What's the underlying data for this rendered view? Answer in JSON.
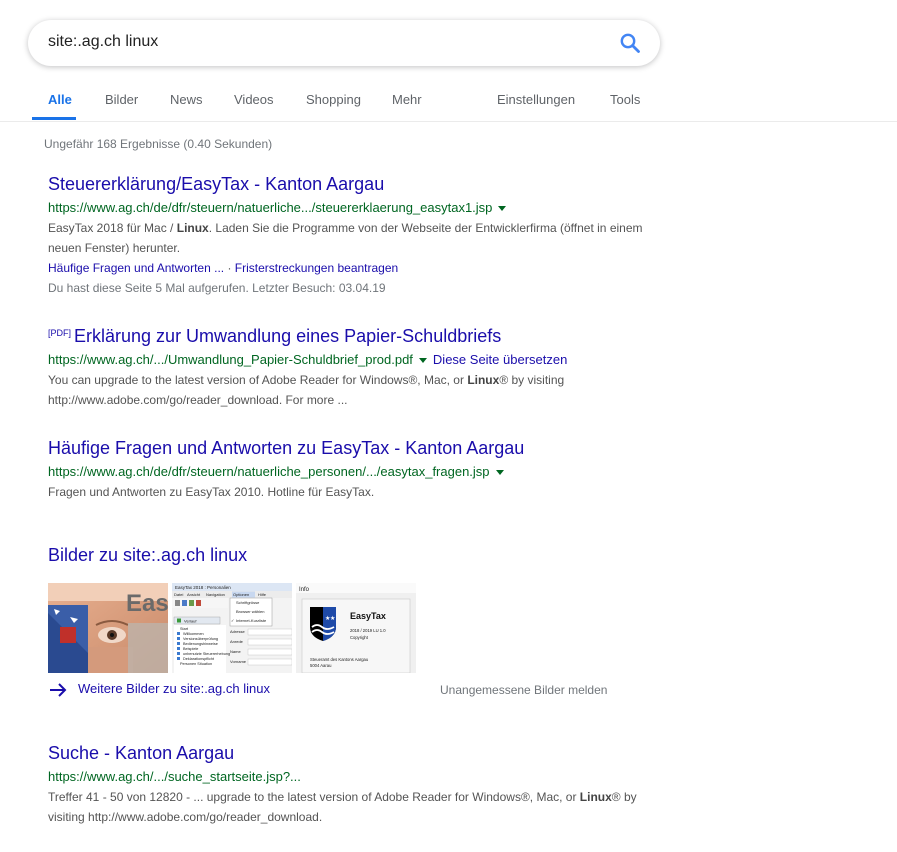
{
  "search": {
    "query": "site:.ag.ch linux"
  },
  "tabs": [
    {
      "label": "Alle",
      "active": true
    },
    {
      "label": "Bilder"
    },
    {
      "label": "News"
    },
    {
      "label": "Videos"
    },
    {
      "label": "Shopping"
    },
    {
      "label": "Mehr"
    },
    {
      "label": "Einstellungen"
    },
    {
      "label": "Tools"
    }
  ],
  "stats": "Ungefähr 168 Ergebnisse (0.40 Sekunden)",
  "results": [
    {
      "title": "Steuererklärung/EasyTax - Kanton Aargau",
      "url": "https://www.ag.ch/de/dfr/steuern/natuerliche.../steuererklaerung_easytax1.jsp",
      "snippet_a": "EasyTax 2018 für Mac / ",
      "snippet_b": "Linux",
      "snippet_c": ". Laden Sie die Programme von der Webseite der Entwicklerfirma (öffnet in einem neuen Fenster) herunter.",
      "sitelink_1": "Häufige Fragen und Antworten ...",
      "sitelink_sep": " · ",
      "sitelink_2": "Fristerstreckungen beantragen",
      "visited": "Du hast diese Seite 5 Mal aufgerufen. Letzter Besuch: 03.04.19"
    },
    {
      "tag": "[PDF]",
      "title": "Erklärung zur Umwandlung eines Papier-Schuldbriefs",
      "url": "https://www.ag.ch/.../Umwandlung_Papier-Schuldbrief_prod.pdf",
      "translate": "Diese Seite übersetzen",
      "snippet_a": "You can upgrade to the latest version of Adobe Reader for Windows®, Mac, or ",
      "snippet_b": "Linux",
      "snippet_c": "® by visiting http://www.adobe.com/go/reader_download. For more ..."
    },
    {
      "title": "Häufige Fragen und Antworten zu EasyTax - Kanton Aargau",
      "url": "https://www.ag.ch/de/dfr/steuern/natuerliche_personen/.../easytax_fragen.jsp",
      "snippet": "Fragen und Antworten zu EasyTax 2010. Hotline für EasyTax."
    },
    {
      "title": "Suche - Kanton Aargau",
      "url": "https://www.ag.ch/.../suche_startseite.jsp?...",
      "snippet_a": "Treffer 41 - 50 von 12820 - ... upgrade to the latest version of Adobe Reader for Windows®, Mac, or ",
      "snippet_b": "Linux",
      "snippet_c": "® by visiting http://www.adobe.com/go/reader_download."
    }
  ],
  "images": {
    "heading": "Bilder zu site:.ag.ch linux",
    "more": "Weitere Bilder zu site:.ag.ch linux",
    "report": "Unangemessene Bilder melden",
    "thumb1": {
      "letters": "Eas"
    },
    "thumb2": {
      "title": "EasyTax 2018 : Personalien",
      "menu": [
        "Datei",
        "Ansicht",
        "Navigation",
        "Optionen",
        "Hilfe"
      ],
      "popup": [
        "Schriftgrösse",
        "Browser wählen",
        "Internet-Kurzliste"
      ],
      "btn": "Verlauf",
      "tree": [
        "Start",
        "Willkommen",
        "Versionsüberprüfung",
        "Bedienungshinweise",
        "Beispiele",
        "unbenutzte Steuererhebung",
        "Deklarationspflicht",
        "Personen Situation"
      ],
      "fields": [
        "Adresse",
        "Anrede",
        "Name",
        "Vorname"
      ]
    },
    "thumb3": {
      "window": "Info",
      "product": "EasyTax",
      "version": "2018 / 2019 LU 1.0",
      "copyright": "Copyright",
      "office": "Steueramt des Kantons Aargau",
      "city": "5004 Aarau"
    }
  },
  "colors": {
    "link": "#1a0dab",
    "url": "#006621",
    "active_tab": "#1a73e8",
    "meta": "#70757a"
  }
}
